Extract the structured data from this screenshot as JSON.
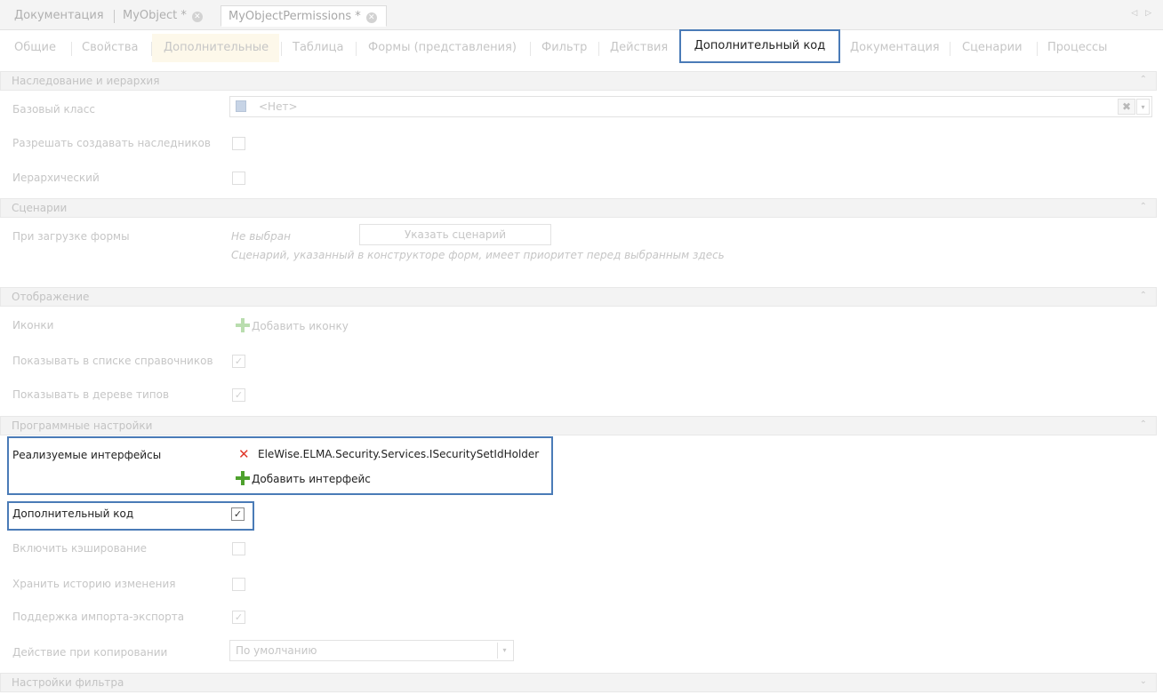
{
  "doc_tabs": {
    "items": [
      {
        "label": "Документация"
      },
      {
        "label": "MyObject *"
      },
      {
        "label": "MyObjectPermissions *"
      }
    ],
    "scroll_icons": "◁ ▷"
  },
  "section_tabs": {
    "items": [
      {
        "label": "Общие"
      },
      {
        "label": "Свойства"
      },
      {
        "label": "Дополнительные"
      },
      {
        "label": "Таблица"
      },
      {
        "label": "Формы (представления)"
      },
      {
        "label": "Фильтр"
      },
      {
        "label": "Действия"
      },
      {
        "label": "Дополнительный код"
      },
      {
        "label": "Документация"
      },
      {
        "label": "Сценарии"
      },
      {
        "label": "Процессы"
      }
    ],
    "active_index": 7
  },
  "inheritance": {
    "header": "Наследование и иерархия",
    "base_class_label": "Базовый класс",
    "base_class_value": "<Нет>",
    "allow_heirs_label": "Разрешать создавать наследников",
    "allow_heirs": false,
    "hierarchical_label": "Иерархический",
    "hierarchical": false
  },
  "scenarios": {
    "header": "Сценарии",
    "on_load_label": "При загрузке формы",
    "on_load_value": "Не выбран",
    "select_button": "Указать сценарий",
    "hint": "Сценарий, указанный в конструкторе форм, имеет приоритет перед выбранным здесь"
  },
  "display": {
    "header": "Отображение",
    "icons_label": "Иконки",
    "add_icon": "Добавить иконку",
    "show_in_list_label": "Показывать в списке справочников",
    "show_in_list": true,
    "show_in_tree_label": "Показывать в дереве типов",
    "show_in_tree": true
  },
  "program_settings": {
    "header": "Программные настройки",
    "interfaces_label": "Реализуемые интерфейсы",
    "interfaces": [
      "EleWise.ELMA.Security.Services.ISecuritySetIdHolder"
    ],
    "add_interface": "Добавить интерфейс",
    "extra_code_label": "Дополнительный код",
    "extra_code": true,
    "caching_label": "Включить кэширование",
    "caching": false,
    "history_label": "Хранить историю изменения",
    "history": false,
    "import_export_label": "Поддержка импорта-экспорта",
    "import_export": true,
    "copy_action_label": "Действие при копировании",
    "copy_action_value": "По умолчанию"
  },
  "filter_settings": {
    "header": "Настройки фильтра"
  },
  "glyphs": {
    "check": "✓",
    "close": "✕",
    "remove": "✕",
    "clear": "✖",
    "dropdown": "▾",
    "collapse": "⌃",
    "expand": "⌄"
  },
  "colors": {
    "accent": "#4a7bb7",
    "add_green": "#4ea12d",
    "remove_red": "#e0392b"
  }
}
